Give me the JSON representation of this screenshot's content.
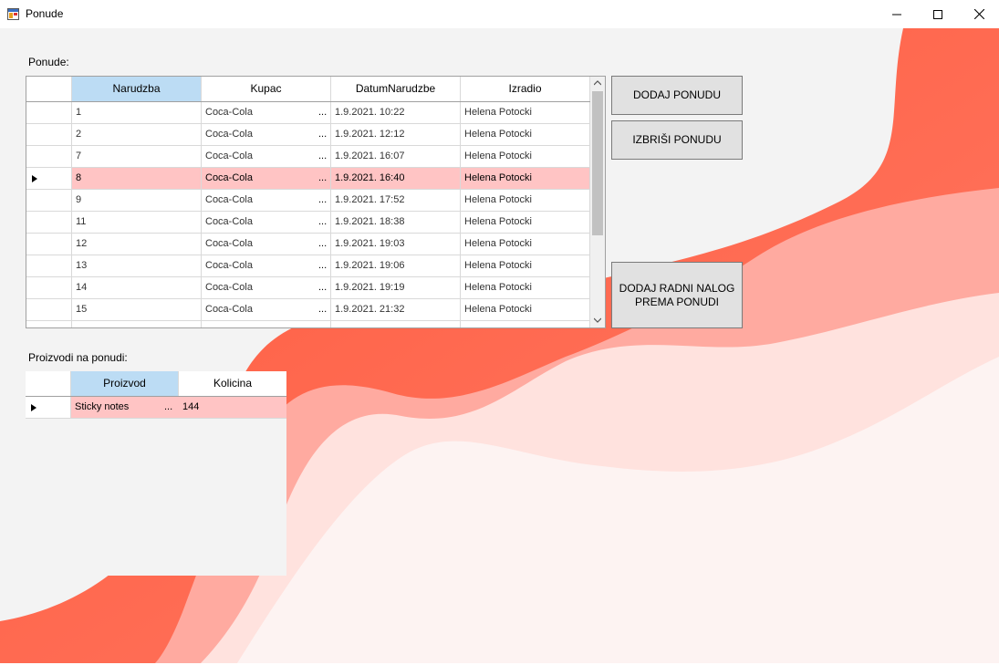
{
  "window": {
    "title": "Ponude",
    "controls": {
      "minimize_icon": "minimize-icon",
      "maximize_icon": "maximize-icon",
      "close_icon": "close-icon"
    }
  },
  "colors": {
    "accent_red": "#ff6650",
    "selection": "#ffc4c4",
    "header_selected": "#bcdcf4",
    "button": "#e1e1e1"
  },
  "ponude": {
    "label": "Ponude:",
    "columns": [
      "Narudzba",
      "Kupac",
      "DatumNarudzbe",
      "Izradio"
    ],
    "rows": [
      {
        "narudzba": "1",
        "kupac": "Coca-Cola",
        "datum": "1.9.2021. 10:22",
        "izradio": "Helena Potocki"
      },
      {
        "narudzba": "2",
        "kupac": "Coca-Cola",
        "datum": "1.9.2021. 12:12",
        "izradio": "Helena Potocki"
      },
      {
        "narudzba": "7",
        "kupac": "Coca-Cola",
        "datum": "1.9.2021. 16:07",
        "izradio": "Helena Potocki"
      },
      {
        "narudzba": "8",
        "kupac": "Coca-Cola",
        "datum": "1.9.2021. 16:40",
        "izradio": "Helena Potocki"
      },
      {
        "narudzba": "9",
        "kupac": "Coca-Cola",
        "datum": "1.9.2021. 17:52",
        "izradio": "Helena Potocki"
      },
      {
        "narudzba": "11",
        "kupac": "Coca-Cola",
        "datum": "1.9.2021. 18:38",
        "izradio": "Helena Potocki"
      },
      {
        "narudzba": "12",
        "kupac": "Coca-Cola",
        "datum": "1.9.2021. 19:03",
        "izradio": "Helena Potocki"
      },
      {
        "narudzba": "13",
        "kupac": "Coca-Cola",
        "datum": "1.9.2021. 19:06",
        "izradio": "Helena Potocki"
      },
      {
        "narudzba": "14",
        "kupac": "Coca-Cola",
        "datum": "1.9.2021. 19:19",
        "izradio": "Helena Potocki"
      },
      {
        "narudzba": "15",
        "kupac": "Coca-Cola",
        "datum": "1.9.2021. 21:32",
        "izradio": "Helena Potocki"
      }
    ],
    "ellipsis": "..."
  },
  "buttons": {
    "dodaj_ponudu": "DODAJ PONUDU",
    "izbrisi_ponudu": "IZBRIŠI PONUDU",
    "dodaj_radni_nalog_line1": "DODAJ RADNI NALOG",
    "dodaj_radni_nalog_line2": "PREMA PONUDI"
  },
  "proizvodi": {
    "label": "Proizvodi na ponudi:",
    "columns": [
      "Proizvod",
      "Kolicina"
    ],
    "rows": [
      {
        "proizvod": "Sticky notes",
        "kolicina": "144"
      }
    ],
    "ellipsis": "..."
  }
}
